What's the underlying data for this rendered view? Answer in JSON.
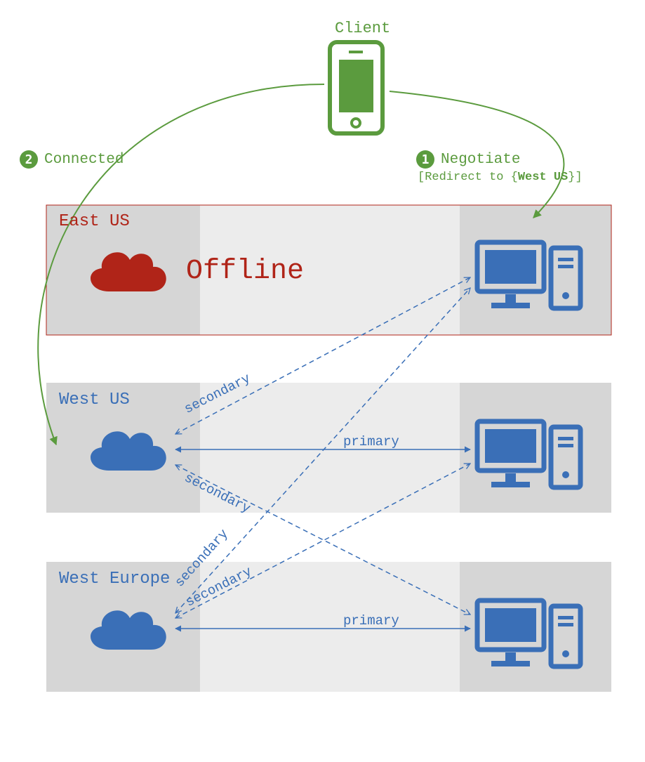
{
  "client": {
    "label": "Client"
  },
  "steps": {
    "connected": {
      "num": "2",
      "label": "Connected"
    },
    "negotiate": {
      "num": "1",
      "label": "Negotiate",
      "redirect_prefix": "[Redirect to {",
      "redirect_region": "West US",
      "redirect_suffix": "}]"
    }
  },
  "regions": {
    "east_us": {
      "name": "East US",
      "status": "Offline"
    },
    "west_us": {
      "name": "West US"
    },
    "west_eu": {
      "name": "West Europe"
    }
  },
  "conn_labels": {
    "primary": "primary",
    "secondary": "secondary"
  },
  "colors": {
    "green": "#5b9b3e",
    "red": "#b02418",
    "blue": "#3a6fb7",
    "grey_dark": "#d6d6d6",
    "grey_light": "#ececec",
    "white": "#ffffff"
  }
}
